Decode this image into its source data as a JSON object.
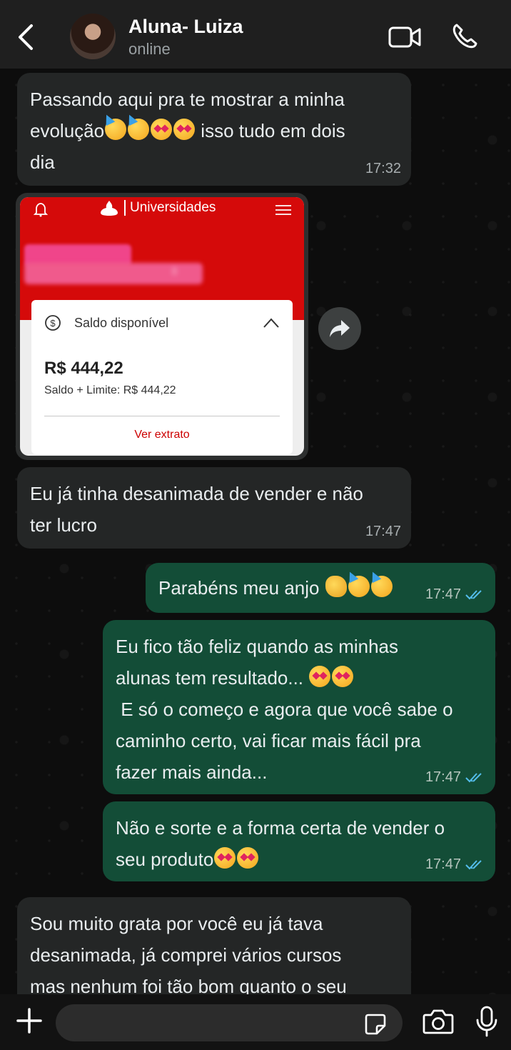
{
  "header": {
    "title": "Aluna- Luiza",
    "status": "online"
  },
  "messages": [
    {
      "id": "m1",
      "direction": "incoming",
      "lines": [
        "Passando aqui pra te mostrar a minha",
        "evolução",
        " isso tudo em dois",
        "dia"
      ],
      "emojis": [
        "partying-face",
        "partying-face",
        "smiling-face-with-hearts",
        "smiling-face-with-hearts"
      ],
      "time": "17:32"
    },
    {
      "id": "m2",
      "direction": "incoming",
      "type": "image",
      "screenshot": {
        "app_title": "Universidades",
        "saldo_label": "Saldo disponível",
        "amount": "R$ 444,22",
        "limit_text": "Saldo + Limite: R$ 444,22",
        "extrato_link": "Ver extrato",
        "blur_digit": "8"
      }
    },
    {
      "id": "m3",
      "direction": "incoming",
      "lines": [
        "Eu já tinha desanimada de vender e não",
        "ter lucro"
      ],
      "time": "17:47"
    },
    {
      "id": "m4",
      "direction": "outgoing",
      "text": "Parabéns meu anjo",
      "emojis": [
        "clapping-hands",
        "partying-face",
        "partying-face"
      ],
      "time": "17:47",
      "read": true
    },
    {
      "id": "m5",
      "direction": "outgoing",
      "lines": [
        "Eu fico tão feliz quando as minhas",
        "alunas tem resultado...",
        " E só o começo e agora que você sabe o",
        "caminho certo, vai ficar mais fácil pra",
        "fazer mais ainda..."
      ],
      "emojis": [
        "smiling-face-with-hearts",
        "smiling-face-with-hearts"
      ],
      "time": "17:47",
      "read": true
    },
    {
      "id": "m6",
      "direction": "outgoing",
      "lines": [
        "Não e sorte e a forma certa de vender o",
        "seu produto"
      ],
      "emojis": [
        "smiling-face-with-hearts",
        "smiling-face-with-hearts"
      ],
      "time": "17:47",
      "read": true
    },
    {
      "id": "m7",
      "direction": "incoming",
      "lines": [
        "Sou muito grata por você eu já tava",
        "desanimada, já comprei vários cursos",
        "mas nenhum foi tão bom quanto o seu"
      ]
    }
  ],
  "composer": {
    "placeholder": ""
  },
  "colors": {
    "incoming_bubble": "#242626",
    "outgoing_bubble": "#134d37",
    "read_ticks": "#53bdeb",
    "bank_red": "#d50a0a"
  },
  "icons": [
    "back-arrow-icon",
    "video-call-icon",
    "phone-call-icon",
    "bell-icon",
    "menu-icon",
    "coin-icon",
    "chevron-up-icon",
    "forward-icon",
    "plus-icon",
    "sticker-icon",
    "camera-icon",
    "mic-icon"
  ]
}
